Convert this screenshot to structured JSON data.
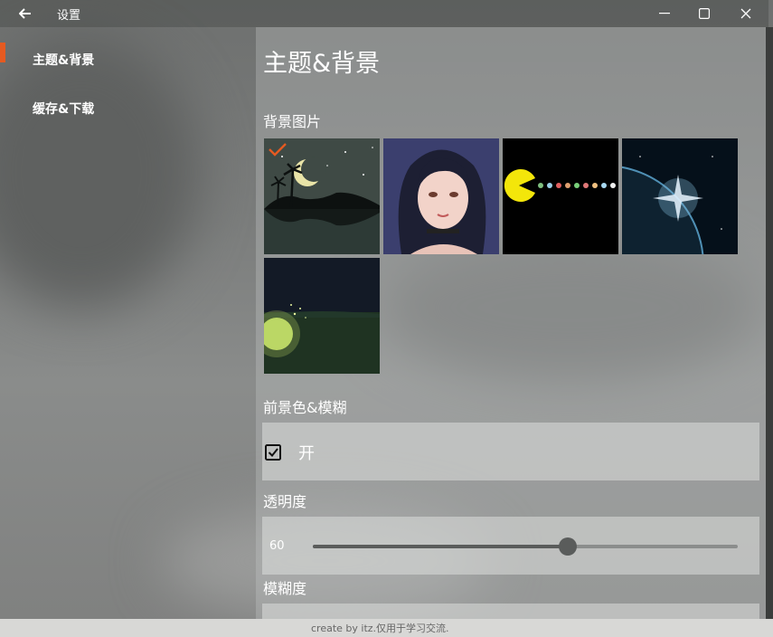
{
  "window": {
    "title": "设置",
    "back_icon": "back-arrow-icon",
    "minimize_icon": "minimize-icon",
    "maximize_icon": "maximize-icon",
    "close_icon": "close-icon"
  },
  "nav": {
    "accent_color": "#e55a21",
    "items": [
      {
        "label": "主题&背景",
        "selected": true
      },
      {
        "label": "缓存&下载",
        "selected": false
      }
    ]
  },
  "content": {
    "page_title": "主题&背景",
    "background_section": {
      "label": "背景图片",
      "selected_index": 0,
      "selected_icon": "checkmark-icon",
      "images": [
        {
          "name": "night-palm-island-moon"
        },
        {
          "name": "anime-girl-portrait"
        },
        {
          "name": "pacman-dots"
        },
        {
          "name": "planet-starburst-space"
        },
        {
          "name": "glowing-orb-night-grass"
        }
      ]
    },
    "foreground_section": {
      "label": "前景色&模糊",
      "checkbox_label": "开",
      "checked": true
    },
    "opacity_section": {
      "label": "透明度",
      "value": "60",
      "fraction": 0.6
    },
    "blur_section": {
      "label": "模糊度"
    }
  },
  "footer": {
    "text": "create by itz.仅用于学习交流."
  }
}
